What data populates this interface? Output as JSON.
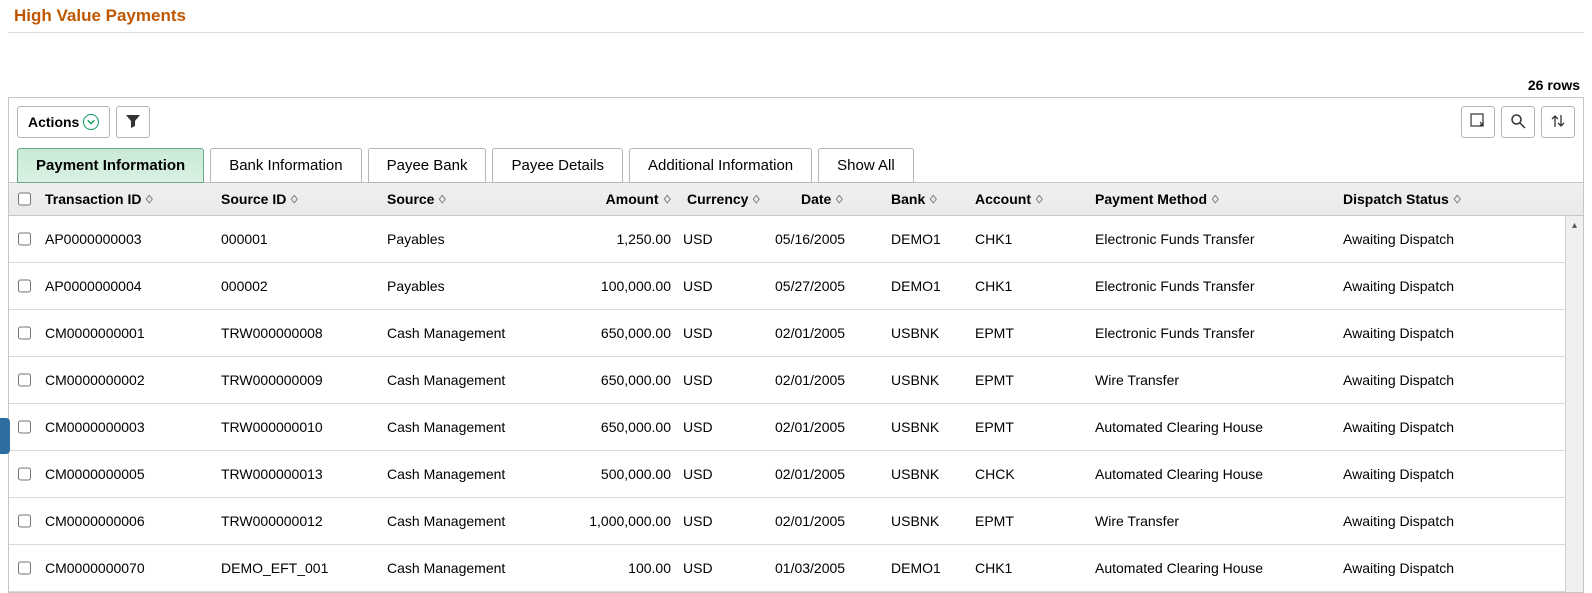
{
  "page": {
    "title": "High Value Payments",
    "row_count_label": "26 rows"
  },
  "toolbar": {
    "actions_label": "Actions"
  },
  "tabs": [
    {
      "label": "Payment Information",
      "active": true
    },
    {
      "label": "Bank Information",
      "active": false
    },
    {
      "label": "Payee Bank",
      "active": false
    },
    {
      "label": "Payee Details",
      "active": false
    },
    {
      "label": "Additional Information",
      "active": false
    },
    {
      "label": "Show All",
      "active": false
    }
  ],
  "columns": {
    "transaction_id": "Transaction ID",
    "source_id": "Source ID",
    "source": "Source",
    "amount": "Amount",
    "currency": "Currency",
    "date": "Date",
    "bank": "Bank",
    "account": "Account",
    "payment_method": "Payment Method",
    "dispatch_status": "Dispatch Status"
  },
  "rows": [
    {
      "transaction_id": "AP0000000003",
      "source_id": "000001",
      "source": "Payables",
      "amount": "1,250.00",
      "currency": "USD",
      "date": "05/16/2005",
      "bank": "DEMO1",
      "account": "CHK1",
      "payment_method": "Electronic Funds Transfer",
      "dispatch_status": "Awaiting Dispatch"
    },
    {
      "transaction_id": "AP0000000004",
      "source_id": "000002",
      "source": "Payables",
      "amount": "100,000.00",
      "currency": "USD",
      "date": "05/27/2005",
      "bank": "DEMO1",
      "account": "CHK1",
      "payment_method": "Electronic Funds Transfer",
      "dispatch_status": "Awaiting Dispatch"
    },
    {
      "transaction_id": "CM0000000001",
      "source_id": "TRW000000008",
      "source": "Cash Management",
      "amount": "650,000.00",
      "currency": "USD",
      "date": "02/01/2005",
      "bank": "USBNK",
      "account": "EPMT",
      "payment_method": "Electronic Funds Transfer",
      "dispatch_status": "Awaiting Dispatch"
    },
    {
      "transaction_id": "CM0000000002",
      "source_id": "TRW000000009",
      "source": "Cash Management",
      "amount": "650,000.00",
      "currency": "USD",
      "date": "02/01/2005",
      "bank": "USBNK",
      "account": "EPMT",
      "payment_method": "Wire Transfer",
      "dispatch_status": "Awaiting Dispatch"
    },
    {
      "transaction_id": "CM0000000003",
      "source_id": "TRW000000010",
      "source": "Cash Management",
      "amount": "650,000.00",
      "currency": "USD",
      "date": "02/01/2005",
      "bank": "USBNK",
      "account": "EPMT",
      "payment_method": "Automated Clearing House",
      "dispatch_status": "Awaiting Dispatch"
    },
    {
      "transaction_id": "CM0000000005",
      "source_id": "TRW000000013",
      "source": "Cash Management",
      "amount": "500,000.00",
      "currency": "USD",
      "date": "02/01/2005",
      "bank": "USBNK",
      "account": "CHCK",
      "payment_method": "Automated Clearing House",
      "dispatch_status": "Awaiting Dispatch"
    },
    {
      "transaction_id": "CM0000000006",
      "source_id": "TRW000000012",
      "source": "Cash Management",
      "amount": "1,000,000.00",
      "currency": "USD",
      "date": "02/01/2005",
      "bank": "USBNK",
      "account": "EPMT",
      "payment_method": "Wire Transfer",
      "dispatch_status": "Awaiting Dispatch"
    },
    {
      "transaction_id": "CM0000000070",
      "source_id": "DEMO_EFT_001",
      "source": "Cash Management",
      "amount": "100.00",
      "currency": "USD",
      "date": "01/03/2005",
      "bank": "DEMO1",
      "account": "CHK1",
      "payment_method": "Automated Clearing House",
      "dispatch_status": "Awaiting Dispatch"
    }
  ]
}
